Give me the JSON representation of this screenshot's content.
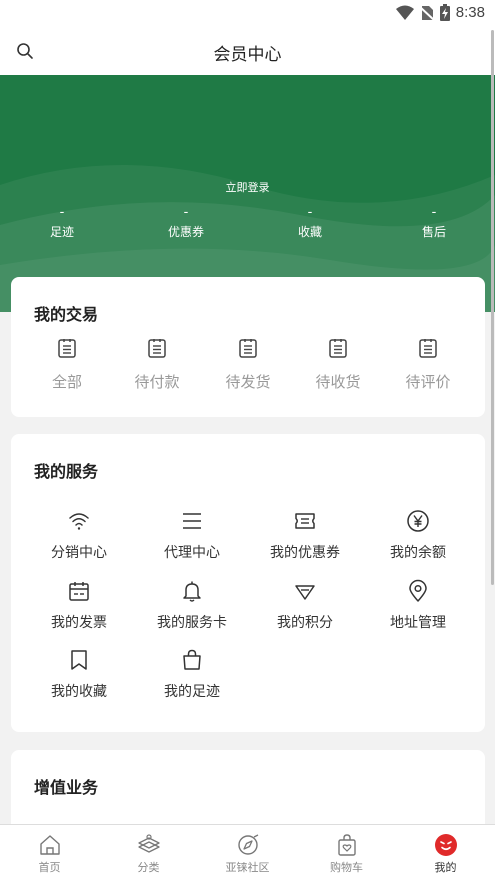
{
  "status_bar": {
    "time": "8:38"
  },
  "header": {
    "title": "会员中心"
  },
  "hero": {
    "login_label": "立即登录",
    "stats": [
      {
        "value": "-",
        "label": "足迹"
      },
      {
        "value": "-",
        "label": "优惠券"
      },
      {
        "value": "-",
        "label": "收藏"
      },
      {
        "value": "-",
        "label": "售后"
      }
    ]
  },
  "trade": {
    "title": "我的交易",
    "items": [
      {
        "label": "全部",
        "icon": "clipboard-icon"
      },
      {
        "label": "待付款",
        "icon": "clipboard-icon"
      },
      {
        "label": "待发货",
        "icon": "clipboard-icon"
      },
      {
        "label": "待收货",
        "icon": "clipboard-icon"
      },
      {
        "label": "待评价",
        "icon": "clipboard-icon"
      }
    ]
  },
  "services": {
    "title": "我的服务",
    "items": [
      {
        "label": "分销中心",
        "icon": "wifi-icon"
      },
      {
        "label": "代理中心",
        "icon": "menu-icon"
      },
      {
        "label": "我的优惠券",
        "icon": "ticket-icon"
      },
      {
        "label": "我的余额",
        "icon": "yen-icon"
      },
      {
        "label": "我的发票",
        "icon": "calendar-icon"
      },
      {
        "label": "我的服务卡",
        "icon": "bell-icon"
      },
      {
        "label": "我的积分",
        "icon": "diamond-icon"
      },
      {
        "label": "地址管理",
        "icon": "location-pin-icon"
      },
      {
        "label": "我的收藏",
        "icon": "bookmark-icon"
      },
      {
        "label": "我的足迹",
        "icon": "shopping-bag-icon"
      }
    ]
  },
  "value_added": {
    "title": "增值业务"
  },
  "tabbar": {
    "items": [
      {
        "label": "首页",
        "icon": "home-icon"
      },
      {
        "label": "分类",
        "icon": "category-icon"
      },
      {
        "label": "亚铼社区",
        "icon": "compass-icon"
      },
      {
        "label": "购物车",
        "icon": "cart-bag-icon"
      },
      {
        "label": "我的",
        "icon": "profile-face-icon",
        "active": true
      }
    ]
  },
  "colors": {
    "brand_green": "#1f7a45",
    "active_red": "#e02a2a",
    "muted_gray": "#999999"
  }
}
